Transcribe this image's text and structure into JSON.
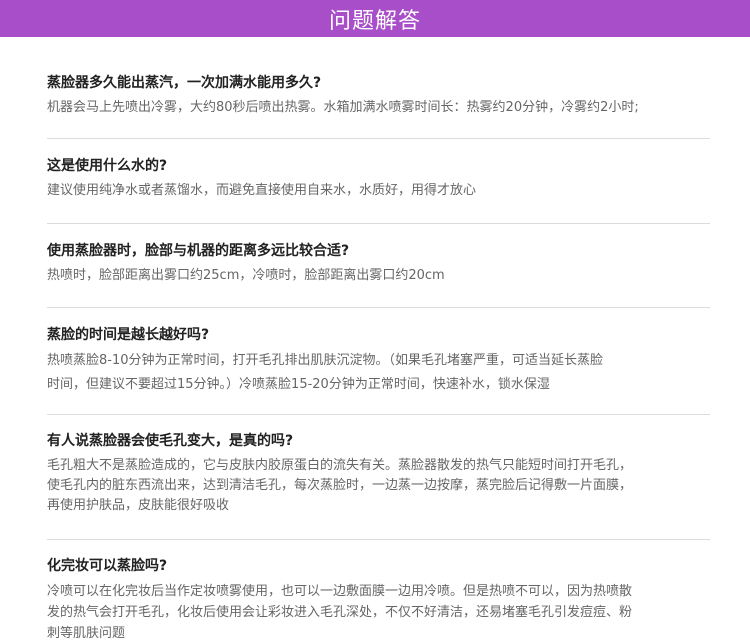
{
  "header": {
    "title": "问题解答",
    "color": "#a84ec9"
  },
  "faq": [
    {
      "question": "蒸脸器多久能出蒸汽，一次加满水能用多久?",
      "answer_lines": [
        "机器会马上先喷出冷雾，大约80秒后喷出热雾。水箱加满水喷雾时间长：热雾约20分钟，冷雾约2小时;"
      ]
    },
    {
      "question": "这是使用什么水的?",
      "answer_lines": [
        "建议使用纯净水或者蒸馏水，而避免直接使用自来水，水质好，用得才放心"
      ]
    },
    {
      "question": "使用蒸脸器时，脸部与机器的距离多远比较合适?",
      "answer_lines": [
        "热喷时，脸部距离出雾口约25cm，冷喷时，脸部距离出雾口约20cm"
      ]
    },
    {
      "question": "蒸脸的时间是越长越好吗?",
      "answer_lines": [
        "热喷蒸脸8-10分钟为正常时间，打开毛孔排出肌肤沉淀物。（如果毛孔堵塞严重，可适当延长蒸脸",
        "时间，但建议不要超过15分钟。）冷喷蒸脸15-20分钟为正常时间，快速补水，锁水保湿"
      ]
    },
    {
      "question": "有人说蒸脸器会使毛孔变大，是真的吗?",
      "answer_lines": [
        "毛孔粗大不是蒸脸造成的，它与皮肤内胶原蛋白的流失有关。蒸脸器散发的热气只能短时间打开毛孔，",
        "使毛孔内的脏东西流出来，达到清洁毛孔，每次蒸脸时，一边蒸一边按摩，蒸完脸后记得敷一片面膜，",
        "再使用护肤品，皮肤能很好吸收"
      ]
    },
    {
      "question": "化完妆可以蒸脸吗?",
      "answer_lines": [
        "冷喷可以在化完妆后当作定妆喷雾使用，也可以一边敷面膜一边用冷喷。但是热喷不可以，因为热喷散",
        "发的热气会打开毛孔，化妆后使用会让彩妆进入毛孔深处，不仅不好清洁，还易堵塞毛孔引发痘痘、粉",
        "刺等肌肤问题"
      ]
    }
  ]
}
